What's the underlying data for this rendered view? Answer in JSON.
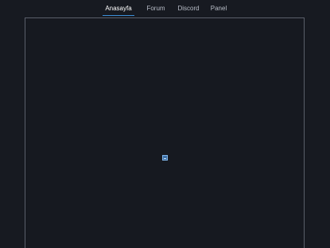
{
  "nav": {
    "items": [
      {
        "label": "Anasayfa",
        "active": true
      },
      {
        "label": "Forum",
        "active": false
      },
      {
        "label": "Discord",
        "active": false
      },
      {
        "label": "Panel",
        "active": false
      }
    ]
  },
  "content": {
    "embedded_image_state": "broken-image",
    "icon": "broken-image-icon"
  },
  "colors": {
    "background": "#171a21",
    "active_underline": "#3d8fd8",
    "frame_border": "#5a5f6a"
  }
}
